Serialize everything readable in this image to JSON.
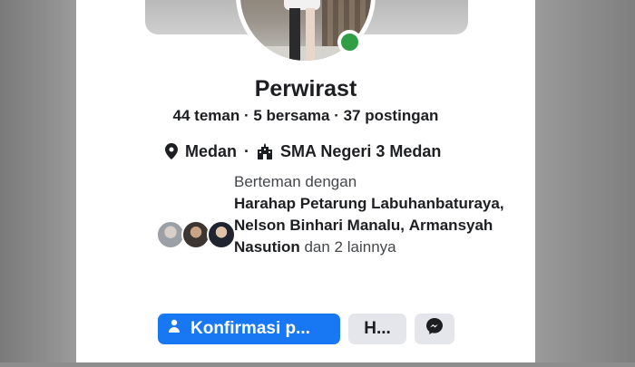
{
  "profile": {
    "name": "Perwirast",
    "stats": "44 teman · 5 bersama · 37 postingan",
    "location": "Medan",
    "school": "SMA Negeri 3 Medan",
    "online": true
  },
  "mutual": {
    "prefix": "Berteman dengan",
    "friend_1": "Harahap Petarung Labuhanbaturaya",
    "friend_2": "Nelson Binhari Manalu",
    "friend_3": "Armansyah Nasution",
    "suffix": "dan 2 lainnya"
  },
  "actions": {
    "confirm_label": "Konfirmasi p...",
    "second_label": "H..."
  },
  "icons": {
    "location": "map-pin-icon",
    "school": "school-building-icon",
    "messenger": "messenger-icon",
    "confirm": "person-add-icon"
  },
  "colors": {
    "primary": "#1877f2",
    "online": "#2f9e44",
    "banner": "#d21f1f"
  }
}
